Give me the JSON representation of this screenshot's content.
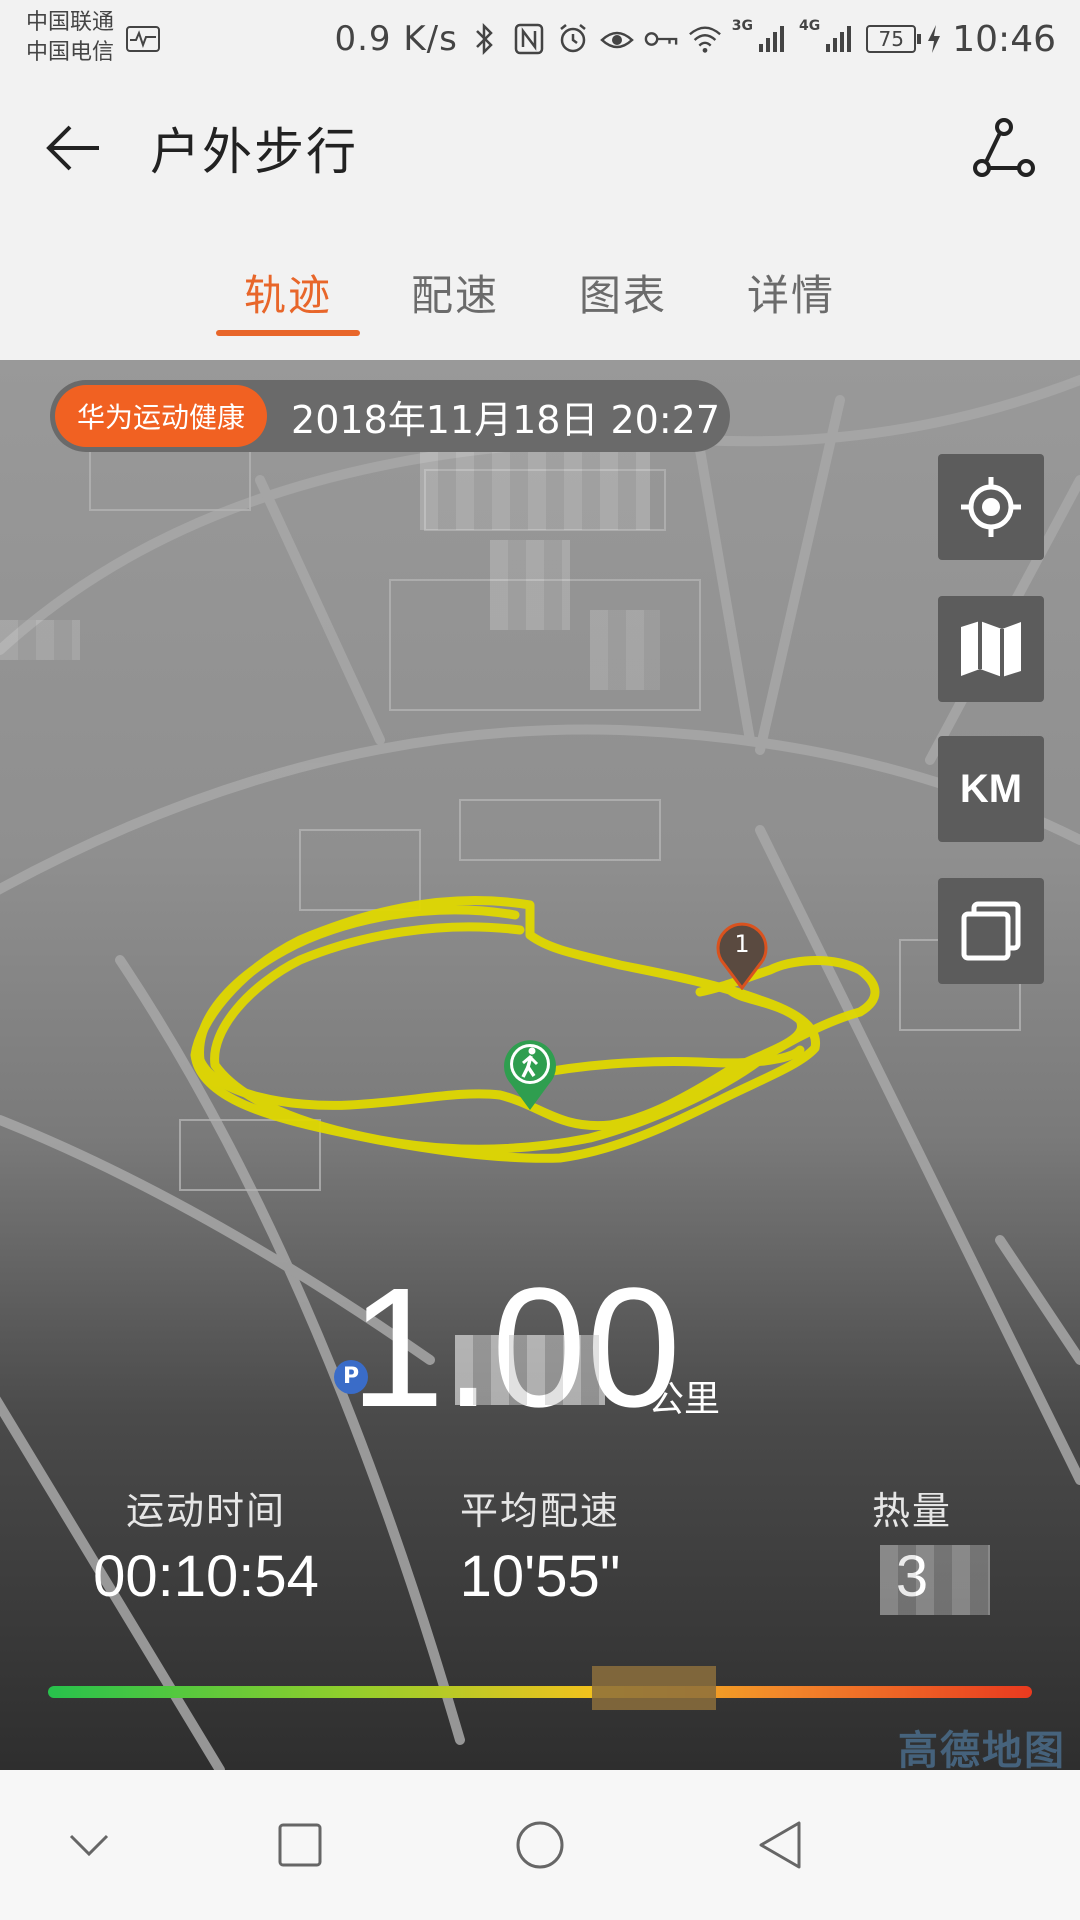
{
  "status_bar": {
    "carrier_1": "中国联通",
    "carrier_2": "中国电信",
    "net_speed": "0.9 K/s",
    "signal_1_label": "3G",
    "signal_2_label": "4G",
    "battery": "75",
    "time": "10:46"
  },
  "header": {
    "title": "户外步行"
  },
  "tabs": [
    {
      "label": "轨迹",
      "active": true
    },
    {
      "label": "配速",
      "active": false
    },
    {
      "label": "图表",
      "active": false
    },
    {
      "label": "详情",
      "active": false
    }
  ],
  "map": {
    "source_badge": "华为运动健康",
    "record_datetime": "2018年11月18日 20:27",
    "controls": {
      "locate_icon": "crosshair-icon",
      "map_type_icon": "map-icon",
      "unit_label": "KM",
      "layers_icon": "layers-icon"
    },
    "km_marker": "1",
    "start_marker_icon": "walker-icon",
    "track_color": "#e0d800",
    "map_brand": "高德地图"
  },
  "summary": {
    "distance_value": "1.00",
    "distance_unit": "公里",
    "stats": [
      {
        "label": "运动时间",
        "value": "00:10:54"
      },
      {
        "label": "平均配速",
        "value": "10'55\""
      },
      {
        "label": "热量",
        "value": "3"
      }
    ]
  },
  "colors": {
    "accent": "#e8662a",
    "badge": "#f16122",
    "pace_start": "#27c24c",
    "pace_end": "#e93a1f"
  }
}
